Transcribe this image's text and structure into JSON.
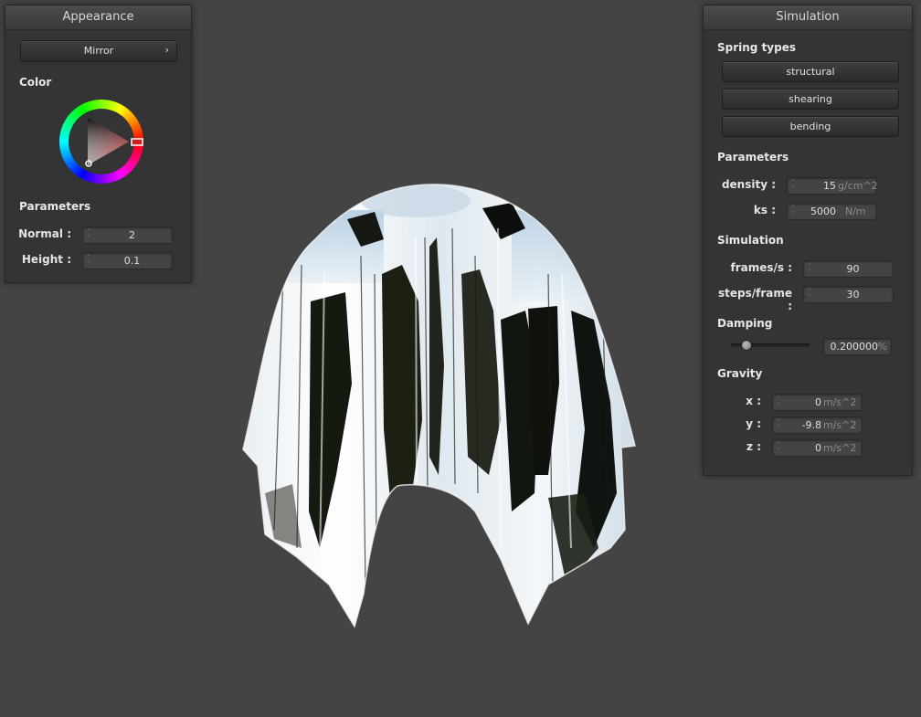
{
  "appearance": {
    "title": "Appearance",
    "shader_button": "Mirror",
    "color_label": "Color",
    "params_label": "Parameters",
    "normal": {
      "label": "Normal :",
      "value": "2"
    },
    "height": {
      "label": "Height :",
      "value": "0.1"
    }
  },
  "simulation": {
    "title": "Simulation",
    "spring_types_label": "Spring types",
    "springs": [
      "structural",
      "shearing",
      "bending"
    ],
    "params_label": "Parameters",
    "density": {
      "label": "density :",
      "value": "15",
      "unit": "g/cm^2"
    },
    "ks": {
      "label": "ks :",
      "value": "5000",
      "unit": "N/m"
    },
    "sim_label": "Simulation",
    "frames": {
      "label": "frames/s :",
      "value": "90"
    },
    "steps": {
      "label": "steps/frame :",
      "value": "30"
    },
    "damping_label": "Damping",
    "damping": {
      "value": "0.200000",
      "unit": "%",
      "slider_fraction": 0.2
    },
    "gravity_label": "Gravity",
    "gravity": [
      {
        "label": "x :",
        "value": "0",
        "unit": "m/s^2"
      },
      {
        "label": "y :",
        "value": "-9.8",
        "unit": "m/s^2"
      },
      {
        "label": "z :",
        "value": "0",
        "unit": "m/s^2"
      }
    ]
  },
  "icons": {
    "chevron": "chevron-right-icon",
    "spinner": "spinner-arrows-icon"
  },
  "colors": {
    "background": "#444444",
    "panel": "#343434",
    "selected_color": "#c02020"
  }
}
